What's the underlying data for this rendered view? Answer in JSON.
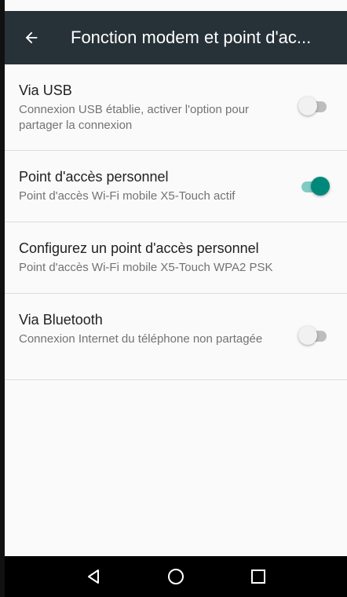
{
  "toolbar": {
    "title": "Fonction modem et point d'ac...",
    "back_icon": "arrow-back-icon",
    "color": "#263238"
  },
  "items": [
    {
      "primary": "Via USB",
      "secondary": "Connexion USB établie, activer l'option pour partager la connexion",
      "switch_on": false
    },
    {
      "primary": "Point d'accès personnel",
      "secondary": "Point d'accès Wi-Fi mobile X5-Touch actif",
      "switch_on": true
    },
    {
      "primary": "Configurez un point d'accès personnel",
      "secondary": "Point d'accès Wi-Fi mobile X5-Touch WPA2 PSK"
    },
    {
      "primary": "Via Bluetooth",
      "secondary": "Connexion Internet du téléphone non partagée",
      "switch_on": false
    }
  ],
  "colors": {
    "accent": "#00897b",
    "accent_track": "#80cbc4"
  },
  "navbar": {
    "icons": [
      "back-triangle-icon",
      "home-circle-icon",
      "recents-square-icon"
    ]
  }
}
